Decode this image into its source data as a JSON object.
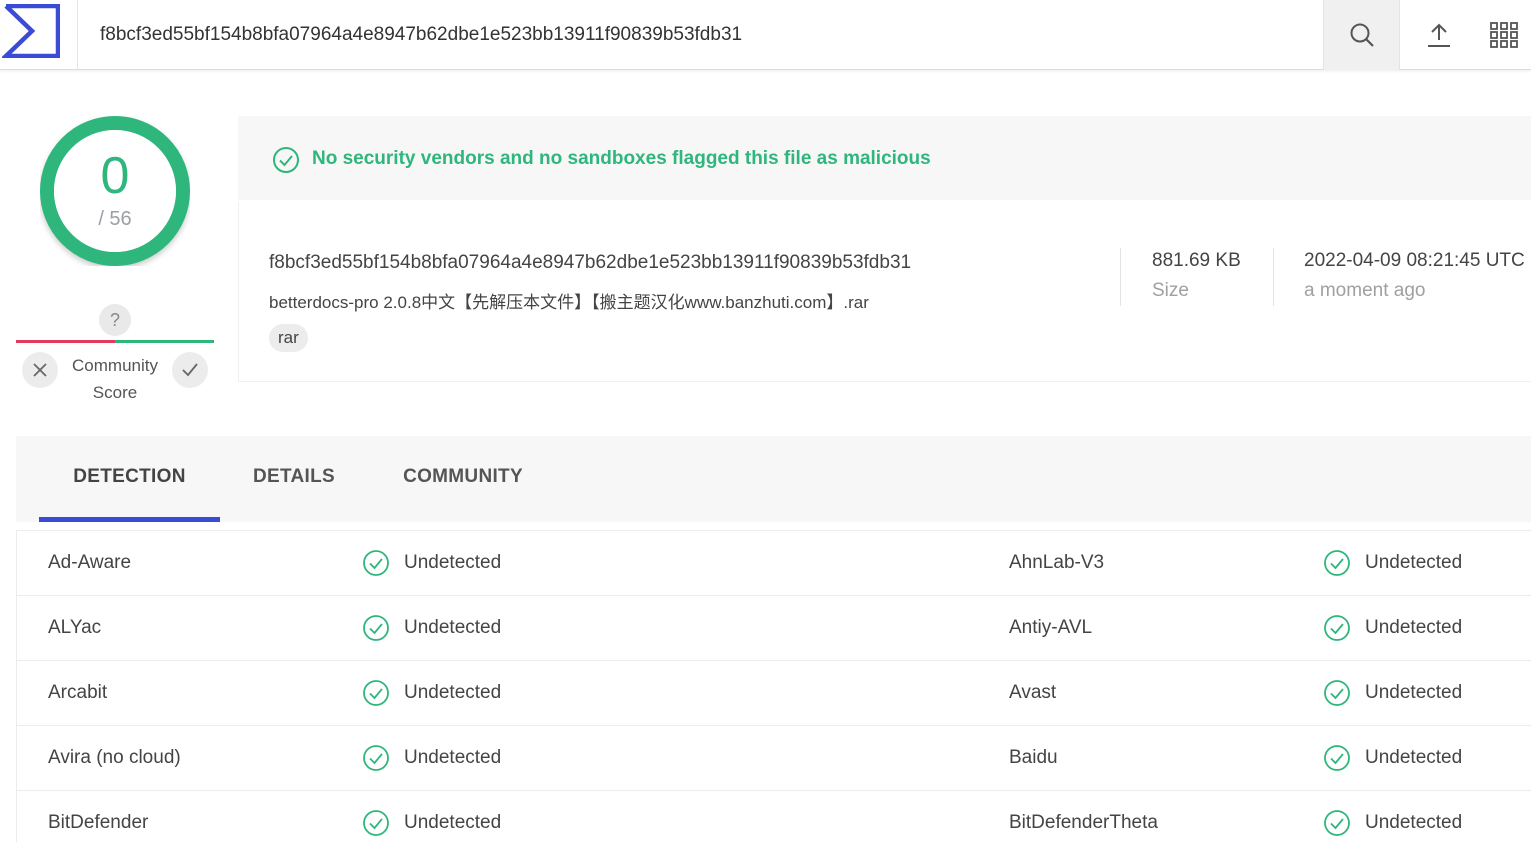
{
  "colors": {
    "accent": "#3a4cd6",
    "clean": "#2fb67c",
    "malicious": "#e23a5e"
  },
  "header": {
    "search_value": "f8bcf3ed55bf154b8bfa07964a4e8947b62dbe1e523bb13911f90839b53fdb31",
    "icons": [
      "search-icon",
      "upload-icon",
      "apps-grid-icon"
    ]
  },
  "score": {
    "detections": "0",
    "total": "/ 56",
    "detected_fraction": 0
  },
  "community": {
    "unknown_mark": "?",
    "label_line1": "Community",
    "label_line2": "Score"
  },
  "banner": {
    "text": "No security vendors and no sandboxes flagged this file as malicious"
  },
  "file": {
    "hash": "f8bcf3ed55bf154b8bfa07964a4e8947b62dbe1e523bb13911f90839b53fdb31",
    "name": "betterdocs-pro 2.0.8中文【先解压本文件】【搬主题汉化www.banzhuti.com】.rar",
    "tag": "rar",
    "size_value": "881.69 KB",
    "size_label": "Size",
    "date_value": "2022-04-09 08:21:45 UTC",
    "date_label": "a moment ago"
  },
  "tabs": [
    {
      "label": "DETECTION",
      "active": true
    },
    {
      "label": "DETAILS",
      "active": false
    },
    {
      "label": "COMMUNITY",
      "active": false
    }
  ],
  "detections": [
    {
      "left_vendor": "Ad-Aware",
      "left_status": "Undetected",
      "right_vendor": "AhnLab-V3",
      "right_status": "Undetected"
    },
    {
      "left_vendor": "ALYac",
      "left_status": "Undetected",
      "right_vendor": "Antiy-AVL",
      "right_status": "Undetected"
    },
    {
      "left_vendor": "Arcabit",
      "left_status": "Undetected",
      "right_vendor": "Avast",
      "right_status": "Undetected"
    },
    {
      "left_vendor": "Avira (no cloud)",
      "left_status": "Undetected",
      "right_vendor": "Baidu",
      "right_status": "Undetected"
    },
    {
      "left_vendor": "BitDefender",
      "left_status": "Undetected",
      "right_vendor": "BitDefenderTheta",
      "right_status": "Undetected"
    }
  ]
}
